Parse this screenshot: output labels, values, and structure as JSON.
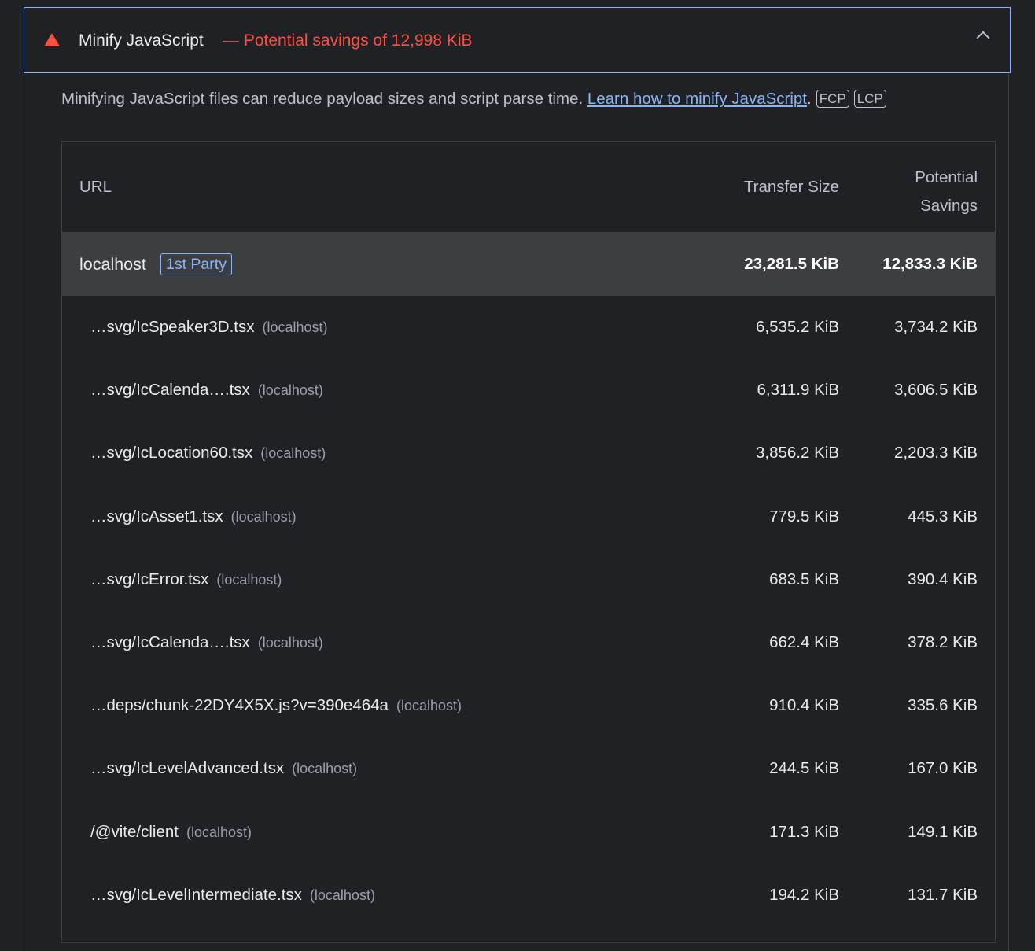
{
  "audit": {
    "title": "Minify JavaScript",
    "savings": "— Potential savings of 12,998 KiB",
    "description_text": "Minifying JavaScript files can reduce payload sizes and script parse time. ",
    "learn_link": "Learn how to minify JavaScript",
    "description_end": ".",
    "metrics": [
      "FCP",
      "LCP"
    ]
  },
  "table": {
    "headers": {
      "url": "URL",
      "transfer_size": "Transfer Size",
      "savings_line1": "Potential",
      "savings_line2": "Savings"
    },
    "group": {
      "name": "localhost",
      "badge": "1st Party",
      "transfer_size": "23,281.5 KiB",
      "savings": "12,833.3 KiB"
    },
    "rows": [
      {
        "url": "…svg/IcSpeaker3D.tsx",
        "host": "(localhost)",
        "size": "6,535.2 KiB",
        "savings": "3,734.2 KiB"
      },
      {
        "url": "…svg/IcCalenda….tsx",
        "host": "(localhost)",
        "size": "6,311.9 KiB",
        "savings": "3,606.5 KiB"
      },
      {
        "url": "…svg/IcLocation60.tsx",
        "host": "(localhost)",
        "size": "3,856.2 KiB",
        "savings": "2,203.3 KiB"
      },
      {
        "url": "…svg/IcAsset1.tsx",
        "host": "(localhost)",
        "size": "779.5 KiB",
        "savings": "445.3 KiB"
      },
      {
        "url": "…svg/IcError.tsx",
        "host": "(localhost)",
        "size": "683.5 KiB",
        "savings": "390.4 KiB"
      },
      {
        "url": "…svg/IcCalenda….tsx",
        "host": "(localhost)",
        "size": "662.4 KiB",
        "savings": "378.2 KiB"
      },
      {
        "url": "…deps/chunk-22DY4X5X.js?v=390e464a",
        "host": "(localhost)",
        "size": "910.4 KiB",
        "savings": "335.6 KiB"
      },
      {
        "url": "…svg/IcLevelAdvanced.tsx",
        "host": "(localhost)",
        "size": "244.5 KiB",
        "savings": "167.0 KiB"
      },
      {
        "url": "/@vite/client",
        "host": "(localhost)",
        "size": "171.3 KiB",
        "savings": "149.1 KiB"
      },
      {
        "url": "…svg/IcLevelIntermediate.tsx",
        "host": "(localhost)",
        "size": "194.2 KiB",
        "savings": "131.7 KiB"
      }
    ]
  }
}
